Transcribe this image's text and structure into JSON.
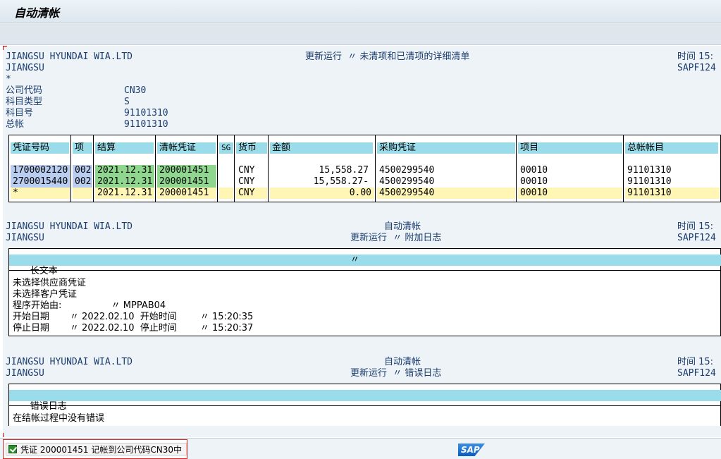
{
  "window": {
    "title": "自动清帐"
  },
  "header1": {
    "company": "JIANGSU HYUNDAI WIA.LTD",
    "company2": "JIANGSU",
    "title": "更新运行  〃 未清项和已清项的详细清单",
    "time_label": "时间 15:",
    "program": "SAPF124",
    "star": "*"
  },
  "params": [
    {
      "label": "公司代码",
      "value": "CN30"
    },
    {
      "label": "科目类型",
      "value": "S"
    },
    {
      "label": "科目号",
      "value": "91101310"
    },
    {
      "label": "总帐",
      "value": "91101310"
    }
  ],
  "table1": {
    "columns": [
      "凭证号码",
      "项",
      "结算",
      "清帐凭证",
      "SG",
      "货币",
      "金额",
      "采购凭证",
      "项目",
      "总帐帐目"
    ],
    "rows": [
      [
        "1700002120",
        "002",
        "2021.12.31",
        "200001451",
        "",
        "CNY",
        "15,558.27",
        "4500299540",
        "00010",
        "91101310"
      ],
      [
        "2700015440",
        "002",
        "2021.12.31",
        "200001451",
        "",
        "CNY",
        "15,558.27-",
        "4500299540",
        "00010",
        "91101310"
      ],
      [
        "*",
        "",
        "2021.12.31",
        "200001451",
        "",
        "CNY",
        "0.00",
        "4500299540",
        "00010",
        "91101310"
      ]
    ]
  },
  "header2": {
    "company": "JIANGSU HYUNDAI WIA.LTD",
    "company2": "JIANGSU",
    "title": "自动清帐",
    "subtitle": "更新运行  〃 附加日志",
    "time_label": "时间 15:",
    "program": "SAPF124"
  },
  "log": {
    "header": "长文本",
    "header_mark": "〃",
    "lines": [
      "未选择供应商凭证",
      "未选择客户凭证",
      "程序开始由:                 〃 MPPAB04",
      "开始日期       〃 2022.02.10  开始时间        〃 15:20:35",
      "停止日期       〃 2022.02.10  停止时间        〃 15:20:37"
    ]
  },
  "header3": {
    "company": "JIANGSU HYUNDAI WIA.LTD",
    "company2": "JIANGSU",
    "title": "自动清帐",
    "subtitle": "更新运行  〃 错误日志",
    "time_label": "时间 15:",
    "program": "SAPF124"
  },
  "errors": {
    "header": "错误日志",
    "line": "在结帐过程中没有错误"
  },
  "status": {
    "message": "凭证 200001451 记帐到公司代码CN30中",
    "icon": "check-icon"
  },
  "brand": {
    "logo": "SAP"
  }
}
